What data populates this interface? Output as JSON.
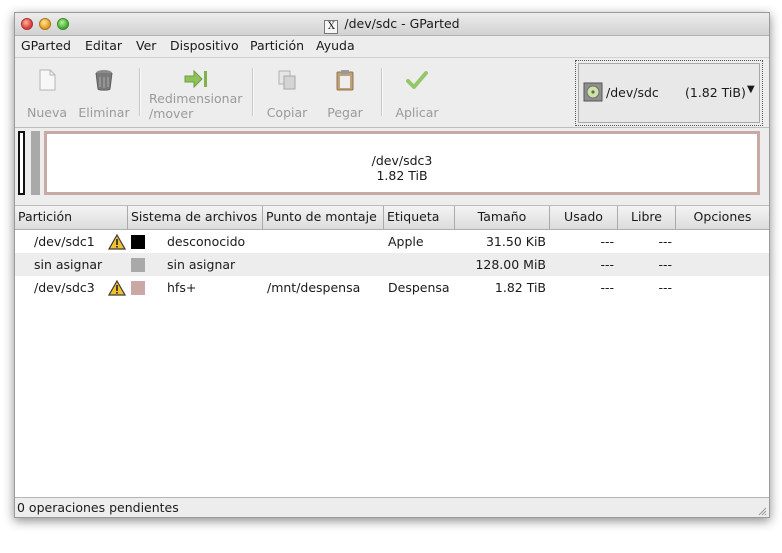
{
  "window": {
    "title": "/dev/sdc - GParted",
    "x_icon": "X"
  },
  "menu": [
    {
      "label": "GParted"
    },
    {
      "label": "Editar"
    },
    {
      "label": "Ver"
    },
    {
      "label": "Dispositivo"
    },
    {
      "label": "Partición"
    },
    {
      "label": "Ayuda"
    }
  ],
  "toolbar": {
    "nueva": "Nueva",
    "eliminar": "Eliminar",
    "redim1": "Redimensionar",
    "redim2": "/mover",
    "copiar": "Copiar",
    "pegar": "Pegar",
    "aplicar": "Aplicar"
  },
  "device": {
    "name": "/dev/sdc",
    "size": "(1.82 TiB)",
    "icon": "harddisk-icon"
  },
  "graphic": {
    "label": "/dev/sdc3",
    "size": "1.82 TiB"
  },
  "table": {
    "headers": [
      "Partición",
      "Sistema de archivos",
      "Punto de montaje",
      "Etiqueta",
      "Tamaño",
      "Usado",
      "Libre",
      "Opciones"
    ],
    "rows": [
      {
        "partition": "/dev/sdc1",
        "warning": true,
        "fs_color": "#000000",
        "fs": "desconocido",
        "mount": "",
        "label": "Apple",
        "size": "31.50 KiB",
        "used": "---",
        "free": "---"
      },
      {
        "partition": "sin asignar",
        "warning": false,
        "fs_color": "#a9a9a9",
        "fs": "sin asignar",
        "mount": "",
        "label": "",
        "size": "128.00 MiB",
        "used": "---",
        "free": "---"
      },
      {
        "partition": "/dev/sdc3",
        "warning": true,
        "fs_color": "#c9a9a5",
        "fs": "hfs+",
        "mount": "/mnt/despensa",
        "label": "Despensa",
        "size": "1.82 TiB",
        "used": "---",
        "free": "---"
      }
    ]
  },
  "status": {
    "text": "0 operaciones pendientes"
  }
}
